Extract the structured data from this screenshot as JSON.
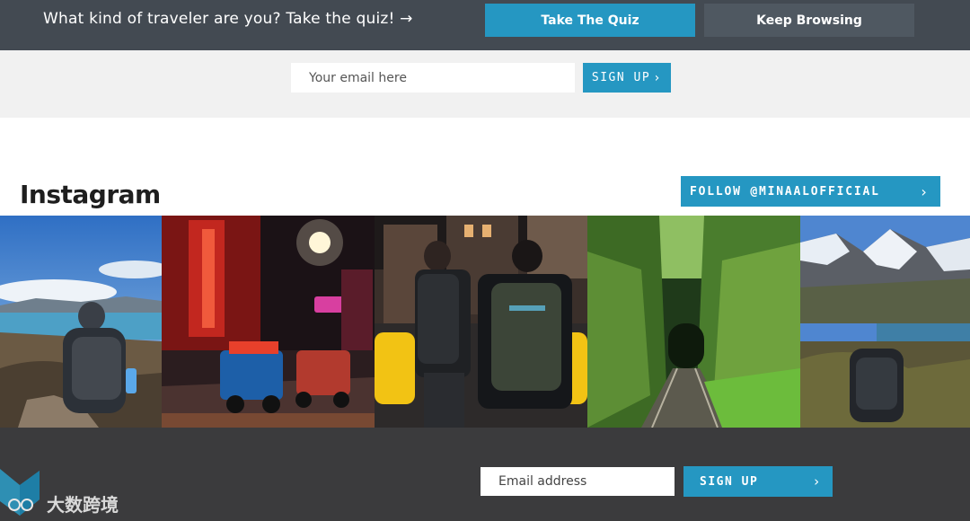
{
  "quiz_bar": {
    "text": "What kind of traveler are you? Take the quiz! →",
    "take_quiz_label": "Take The Quiz",
    "keep_browsing_label": "Keep Browsing"
  },
  "newsletter": {
    "placeholder": "Your email here",
    "signup_label": "SIGN UP",
    "chevron": "›"
  },
  "instagram": {
    "title": "Instagram",
    "follow_label": "FOLLOW @MINAALOFFICIAL",
    "chevron": "›",
    "photos": [
      {
        "icon": "hiker-mountain-lake-photo"
      },
      {
        "icon": "neon-street-tuktuk-photo"
      },
      {
        "icon": "two-travelers-backpacks-city-photo"
      },
      {
        "icon": "forest-railway-tunnel-photo"
      },
      {
        "icon": "backpack-alpine-lake-photo"
      }
    ]
  },
  "footer": {
    "placeholder": "Email address",
    "signup_label": "SIGN UP",
    "chevron": "›"
  },
  "watermark": {
    "text": "大数跨境"
  },
  "colors": {
    "accent": "#2597c2",
    "topbar": "#434a52",
    "footer": "#3b3b3d"
  }
}
